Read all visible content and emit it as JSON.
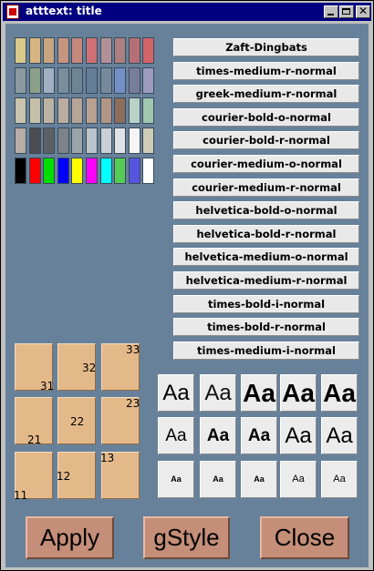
{
  "window": {
    "title": "atttext: title"
  },
  "palette": {
    "rows": [
      [
        "#d9c98a",
        "#d7b581",
        "#c9a57f",
        "#c69580",
        "#c4887d",
        "#d07074",
        "#b29196",
        "#ae7f80",
        "#b66f75",
        "#d36468"
      ],
      [
        "#8a9aa0",
        "#8ba087",
        "#a1b0c2",
        "#7a8d9d",
        "#6f8494",
        "#657e97",
        "#768a9c",
        "#7390c6",
        "#797d9d",
        "#9d9bbd"
      ],
      [
        "#c8c4ad",
        "#c6c0a8",
        "#bcb2a2",
        "#baad9f",
        "#b6a497",
        "#b9a08f",
        "#b19585",
        "#8d6d5c",
        "#b8d2c8",
        "#a0c7b0"
      ],
      [
        "#b8aea8",
        "#4a4d52",
        "#5d6166",
        "#7c8389",
        "#9ba3ab",
        "#bcc3ca",
        "#c8d0d5",
        "#e0e3e6",
        "#f5f5f5",
        "#cfcbb5"
      ],
      [
        "#000000",
        "#ff0000",
        "#00dd00",
        "#0000ff",
        "#ffff00",
        "#ff00ff",
        "#00ffff",
        "#55cc55",
        "#5555dd",
        "#ffffff"
      ]
    ]
  },
  "fonts": [
    "Zaft-Dingbats",
    "times-medium-r-normal",
    "greek-medium-r-normal",
    "courier-bold-o-normal",
    "courier-bold-r-normal",
    "courier-medium-o-normal",
    "courier-medium-r-normal",
    "helvetica-bold-o-normal",
    "helvetica-bold-r-normal",
    "helvetica-medium-o-normal",
    "helvetica-medium-r-normal",
    "times-bold-i-normal",
    "times-bold-r-normal",
    "times-medium-i-normal"
  ],
  "positions": [
    {
      "label": "31",
      "corner": "bottom-right"
    },
    {
      "label": "32",
      "corner": "center-right"
    },
    {
      "label": "33",
      "corner": "top-right"
    },
    {
      "label": "21",
      "corner": "bottom-left"
    },
    {
      "label": "22",
      "corner": "center"
    },
    {
      "label": "23",
      "corner": "top-right"
    },
    {
      "label": "11",
      "corner": "bottom-left"
    },
    {
      "label": "12",
      "corner": "center-left"
    },
    {
      "label": "13",
      "corner": "top-left"
    }
  ],
  "style_samples": {
    "text": "Aa",
    "rows": [
      [
        "large-medium",
        "large-light",
        "large-bold",
        "large-bold",
        "large-bold"
      ],
      [
        "medium-medium",
        "medium-bold",
        "medium-bold",
        "medium-medium",
        "medium-medium"
      ],
      [
        "small-bold",
        "small-bold",
        "small-bold",
        "small-medium",
        "small-medium"
      ]
    ]
  },
  "buttons": {
    "apply": "Apply",
    "gstyle": "gStyle",
    "close": "Close"
  }
}
